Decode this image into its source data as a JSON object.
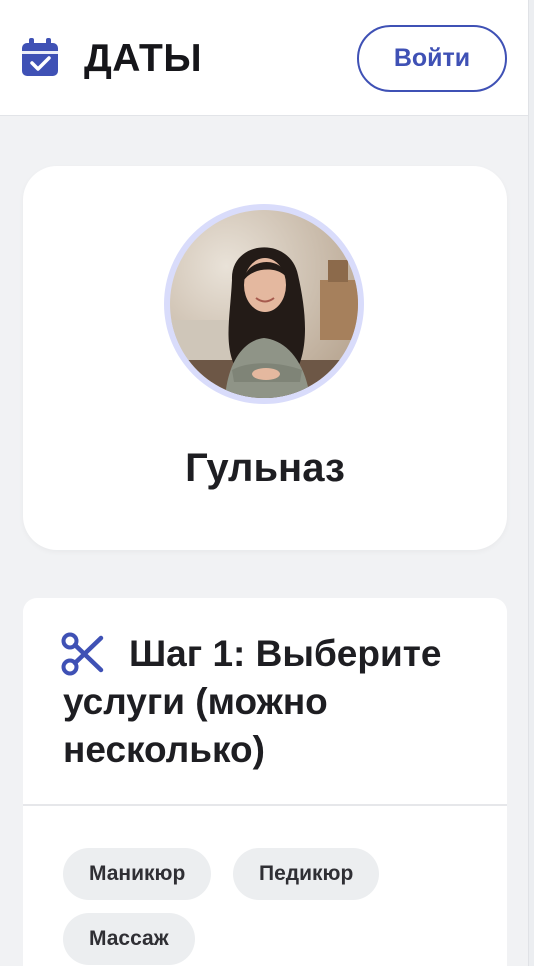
{
  "header": {
    "logo_icon": "calendar-check-icon",
    "logo_text": "ДАТЫ",
    "login_label": "Войти",
    "accent_color": "#3f51b5"
  },
  "profile": {
    "name": "Гульназ",
    "avatar_ring_color": "#d9dcfb"
  },
  "step1": {
    "icon": "scissors-icon",
    "title": "Шаг 1: Выберите услуги (можно несколько)",
    "services": [
      "Маникюр",
      "Педикюр",
      "Массаж"
    ]
  }
}
